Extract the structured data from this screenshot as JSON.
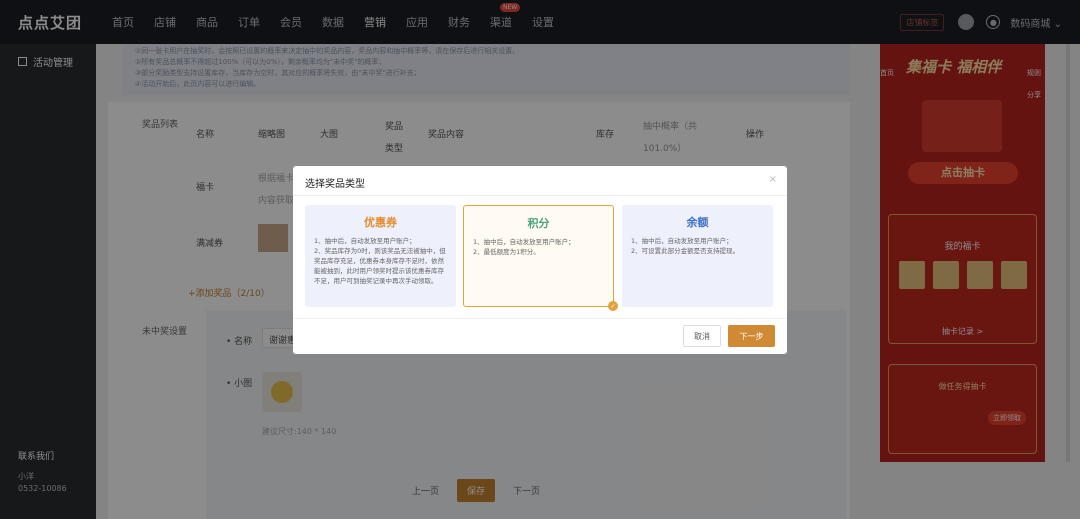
{
  "app": {
    "logo": "点点艾团",
    "nav": [
      {
        "label": "首页"
      },
      {
        "label": "店铺"
      },
      {
        "label": "商品"
      },
      {
        "label": "订单"
      },
      {
        "label": "会员"
      },
      {
        "label": "数据"
      },
      {
        "label": "营销",
        "active": true
      },
      {
        "label": "应用"
      },
      {
        "label": "财务"
      },
      {
        "label": "渠道",
        "badge": "NEW"
      },
      {
        "label": "设置"
      }
    ],
    "shop_tag": "店铺标签",
    "shop_name": "数码商城"
  },
  "sidebar": {
    "item": "活动管理",
    "contact_title": "联系我们",
    "contact_name": "小洋",
    "contact_phone": "0532-10086"
  },
  "notice": {
    "lines": [
      "①同一张卡用户在抽奖时，会按照已设置的概率来决定抽中的奖品内容，奖品内容和抽中概率等，请在保存后进行相关设置。",
      "②所有奖品总概率不得超过100%（可以为0%），剩余概率均为\"未中奖\"的概率；",
      "③部分奖励类型支持设置库存，当库存为空时，其对应的概率将失效，由\"未中奖\"进行补充；",
      "④活动开始后，此页内容可以进行编辑。"
    ]
  },
  "prize_table": {
    "section_label": "奖品列表",
    "headers": [
      "名称",
      "缩略图",
      "大图",
      "奖品类型",
      "奖品内容",
      "库存",
      "抽中概率（共101.0%）",
      "操作"
    ],
    "rows": [
      {
        "name": "福卡",
        "thumb_note": "根据福卡内容获取"
      },
      {
        "name": "满减券"
      }
    ],
    "add_label": "+添加奖品（2/10）"
  },
  "nowin": {
    "section_label": "未中奖设置",
    "name_label": "• 名称",
    "name_value": "谢谢惠顾",
    "icon_label": "• 小图",
    "size_hint": "建议尺寸:140 * 140"
  },
  "footer": {
    "prev": "上一页",
    "save": "保存",
    "next": "下一页"
  },
  "phone": {
    "title": "集福卡 福相伴",
    "home": "首页",
    "rules": "规则",
    "share": "分享",
    "draw_label": "点击抽卡",
    "my_cards": "我的福卡",
    "record": "抽卡记录 >",
    "task": "做任务得抽卡",
    "task_btn": "立即领取"
  },
  "dialog": {
    "title": "选择奖品类型",
    "close": "×",
    "cards": [
      {
        "title": "优惠券",
        "color": "#e58a2c",
        "desc": [
          "1、抽中后，自动发放至用户账户；",
          "2、奖品库存为0时，则该奖品无法被抽中，但奖品库存充足，优惠券本身库存不足时，依然能被抽到，此时用户领奖时提示该优惠券库存不足，用户可到抽奖记录中再次手动领取。"
        ]
      },
      {
        "title": "积分",
        "color": "#4aa57c",
        "desc": [
          "1、抽中后，自动发放至用户账户；",
          "2、最低额度为1积分。"
        ],
        "selected": true
      },
      {
        "title": "余额",
        "color": "#3f6fc6",
        "desc": [
          "1、抽中后，自动发放至用户账户；",
          "2、可设置此部分金额是否支持提现。"
        ]
      }
    ],
    "cancel": "取消",
    "next": "下一步"
  }
}
